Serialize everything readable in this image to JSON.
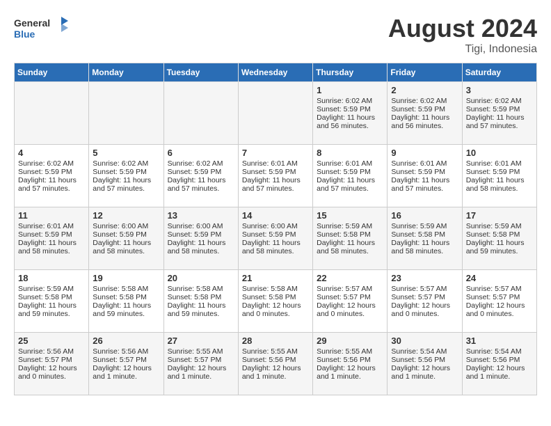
{
  "header": {
    "logo_line1": "General",
    "logo_line2": "Blue",
    "month_year": "August 2024",
    "location": "Tigi, Indonesia"
  },
  "days_of_week": [
    "Sunday",
    "Monday",
    "Tuesday",
    "Wednesday",
    "Thursday",
    "Friday",
    "Saturday"
  ],
  "weeks": [
    [
      {
        "day": "",
        "info": ""
      },
      {
        "day": "",
        "info": ""
      },
      {
        "day": "",
        "info": ""
      },
      {
        "day": "",
        "info": ""
      },
      {
        "day": "1",
        "info": "Sunrise: 6:02 AM\nSunset: 5:59 PM\nDaylight: 11 hours and 56 minutes."
      },
      {
        "day": "2",
        "info": "Sunrise: 6:02 AM\nSunset: 5:59 PM\nDaylight: 11 hours and 56 minutes."
      },
      {
        "day": "3",
        "info": "Sunrise: 6:02 AM\nSunset: 5:59 PM\nDaylight: 11 hours and 57 minutes."
      }
    ],
    [
      {
        "day": "4",
        "info": "Sunrise: 6:02 AM\nSunset: 5:59 PM\nDaylight: 11 hours and 57 minutes."
      },
      {
        "day": "5",
        "info": "Sunrise: 6:02 AM\nSunset: 5:59 PM\nDaylight: 11 hours and 57 minutes."
      },
      {
        "day": "6",
        "info": "Sunrise: 6:02 AM\nSunset: 5:59 PM\nDaylight: 11 hours and 57 minutes."
      },
      {
        "day": "7",
        "info": "Sunrise: 6:01 AM\nSunset: 5:59 PM\nDaylight: 11 hours and 57 minutes."
      },
      {
        "day": "8",
        "info": "Sunrise: 6:01 AM\nSunset: 5:59 PM\nDaylight: 11 hours and 57 minutes."
      },
      {
        "day": "9",
        "info": "Sunrise: 6:01 AM\nSunset: 5:59 PM\nDaylight: 11 hours and 57 minutes."
      },
      {
        "day": "10",
        "info": "Sunrise: 6:01 AM\nSunset: 5:59 PM\nDaylight: 11 hours and 58 minutes."
      }
    ],
    [
      {
        "day": "11",
        "info": "Sunrise: 6:01 AM\nSunset: 5:59 PM\nDaylight: 11 hours and 58 minutes."
      },
      {
        "day": "12",
        "info": "Sunrise: 6:00 AM\nSunset: 5:59 PM\nDaylight: 11 hours and 58 minutes."
      },
      {
        "day": "13",
        "info": "Sunrise: 6:00 AM\nSunset: 5:59 PM\nDaylight: 11 hours and 58 minutes."
      },
      {
        "day": "14",
        "info": "Sunrise: 6:00 AM\nSunset: 5:59 PM\nDaylight: 11 hours and 58 minutes."
      },
      {
        "day": "15",
        "info": "Sunrise: 5:59 AM\nSunset: 5:58 PM\nDaylight: 11 hours and 58 minutes."
      },
      {
        "day": "16",
        "info": "Sunrise: 5:59 AM\nSunset: 5:58 PM\nDaylight: 11 hours and 58 minutes."
      },
      {
        "day": "17",
        "info": "Sunrise: 5:59 AM\nSunset: 5:58 PM\nDaylight: 11 hours and 59 minutes."
      }
    ],
    [
      {
        "day": "18",
        "info": "Sunrise: 5:59 AM\nSunset: 5:58 PM\nDaylight: 11 hours and 59 minutes."
      },
      {
        "day": "19",
        "info": "Sunrise: 5:58 AM\nSunset: 5:58 PM\nDaylight: 11 hours and 59 minutes."
      },
      {
        "day": "20",
        "info": "Sunrise: 5:58 AM\nSunset: 5:58 PM\nDaylight: 11 hours and 59 minutes."
      },
      {
        "day": "21",
        "info": "Sunrise: 5:58 AM\nSunset: 5:58 PM\nDaylight: 12 hours and 0 minutes."
      },
      {
        "day": "22",
        "info": "Sunrise: 5:57 AM\nSunset: 5:57 PM\nDaylight: 12 hours and 0 minutes."
      },
      {
        "day": "23",
        "info": "Sunrise: 5:57 AM\nSunset: 5:57 PM\nDaylight: 12 hours and 0 minutes."
      },
      {
        "day": "24",
        "info": "Sunrise: 5:57 AM\nSunset: 5:57 PM\nDaylight: 12 hours and 0 minutes."
      }
    ],
    [
      {
        "day": "25",
        "info": "Sunrise: 5:56 AM\nSunset: 5:57 PM\nDaylight: 12 hours and 0 minutes."
      },
      {
        "day": "26",
        "info": "Sunrise: 5:56 AM\nSunset: 5:57 PM\nDaylight: 12 hours and 1 minute."
      },
      {
        "day": "27",
        "info": "Sunrise: 5:55 AM\nSunset: 5:57 PM\nDaylight: 12 hours and 1 minute."
      },
      {
        "day": "28",
        "info": "Sunrise: 5:55 AM\nSunset: 5:56 PM\nDaylight: 12 hours and 1 minute."
      },
      {
        "day": "29",
        "info": "Sunrise: 5:55 AM\nSunset: 5:56 PM\nDaylight: 12 hours and 1 minute."
      },
      {
        "day": "30",
        "info": "Sunrise: 5:54 AM\nSunset: 5:56 PM\nDaylight: 12 hours and 1 minute."
      },
      {
        "day": "31",
        "info": "Sunrise: 5:54 AM\nSunset: 5:56 PM\nDaylight: 12 hours and 1 minute."
      }
    ]
  ]
}
